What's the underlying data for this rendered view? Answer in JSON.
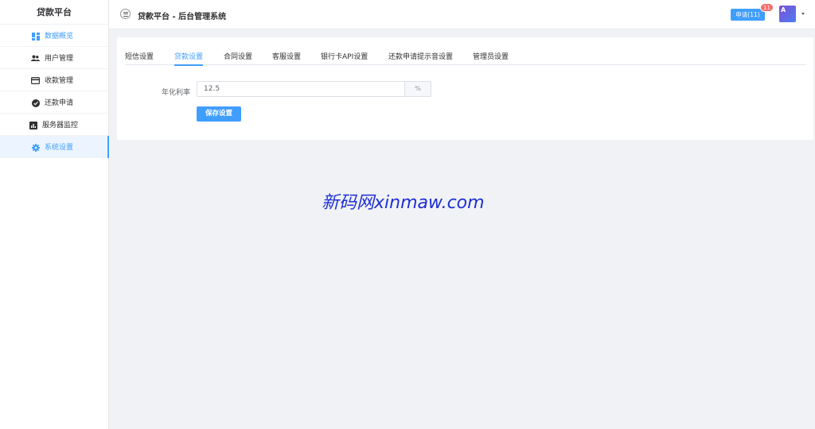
{
  "sidebar": {
    "brand": "贷款平台",
    "items": [
      {
        "label": "数据概览",
        "icon": "dashboard-icon"
      },
      {
        "label": "用户管理",
        "icon": "users-icon"
      },
      {
        "label": "收款管理",
        "icon": "card-icon"
      },
      {
        "label": "还款申请",
        "icon": "check-circle-icon"
      },
      {
        "label": "服务器监控",
        "icon": "chart-icon"
      },
      {
        "label": "系统设置",
        "icon": "gear-icon"
      }
    ]
  },
  "header": {
    "title": "贷款平台 - 后台管理系统",
    "apply_label": "申请(11)",
    "badge_count": "11",
    "avatar_letter": "A"
  },
  "tabs": [
    {
      "label": "短信设置"
    },
    {
      "label": "贷款设置"
    },
    {
      "label": "合同设置"
    },
    {
      "label": "客服设置"
    },
    {
      "label": "银行卡API设置"
    },
    {
      "label": "还款申请提示音设置"
    },
    {
      "label": "管理员设置"
    }
  ],
  "form": {
    "rate_label": "年化利率",
    "rate_value": "12.5",
    "rate_suffix": "%",
    "save_label": "保存设置"
  },
  "watermark": "新码网xinmaw.com",
  "colors": {
    "primary": "#409eff",
    "badge": "#f56c6c",
    "watermark": "#1f2fd6"
  }
}
